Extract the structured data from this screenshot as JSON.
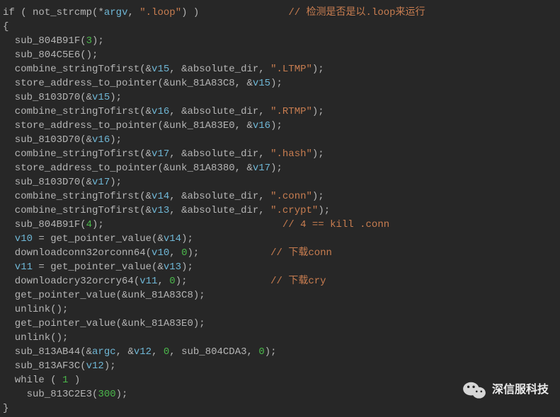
{
  "code": {
    "l1_kw": "if",
    "l1_p1": " ( ",
    "l1_fn": "not_strcmp",
    "l1_p2": "(",
    "l1_star": "*",
    "l1_arg": "argv",
    "l1_c": ", ",
    "l1_s": "\".loop\"",
    "l1_p3": ")",
    "l1_p4": " )",
    "l1_pad": "               ",
    "l1_cmt": "// 检测是否是以.loop来运行",
    "l2": "{",
    "l3_fn": "  sub_804B91F",
    "l3_p1": "(",
    "l3_n": "3",
    "l3_p2": ");",
    "l4": "  sub_804C5E6();",
    "l5_fn": "  combine_stringTofirst",
    "l5_p1": "(&",
    "l5_v": "v15",
    "l5_c1": ", &absolute_dir, ",
    "l5_s": "\".LTMP\"",
    "l5_p2": ");",
    "l6_fn": "  store_address_to_pointer",
    "l6_p1": "(&unk_81A83C8, &",
    "l6_v": "v15",
    "l6_p2": ");",
    "l7_fn": "  sub_8103D70",
    "l7_p1": "(&",
    "l7_v": "v15",
    "l7_p2": ");",
    "l8_fn": "  combine_stringTofirst",
    "l8_p1": "(&",
    "l8_v": "v16",
    "l8_c1": ", &absolute_dir, ",
    "l8_s": "\".RTMP\"",
    "l8_p2": ");",
    "l9_fn": "  store_address_to_pointer",
    "l9_p1": "(&unk_81A83E0, &",
    "l9_v": "v16",
    "l9_p2": ");",
    "l10_fn": "  sub_8103D70",
    "l10_p1": "(&",
    "l10_v": "v16",
    "l10_p2": ");",
    "l11_fn": "  combine_stringTofirst",
    "l11_p1": "(&",
    "l11_v": "v17",
    "l11_c1": ", &absolute_dir, ",
    "l11_s": "\".hash\"",
    "l11_p2": ");",
    "l12_fn": "  store_address_to_pointer",
    "l12_p1": "(&unk_81A8380, &",
    "l12_v": "v17",
    "l12_p2": ");",
    "l13_fn": "  sub_8103D70",
    "l13_p1": "(&",
    "l13_v": "v17",
    "l13_p2": ");",
    "l14_fn": "  combine_stringTofirst",
    "l14_p1": "(&",
    "l14_v": "v14",
    "l14_c1": ", &absolute_dir, ",
    "l14_s": "\".conn\"",
    "l14_p2": ");",
    "l15_fn": "  combine_stringTofirst",
    "l15_p1": "(&",
    "l15_v": "v13",
    "l15_c1": ", &absolute_dir, ",
    "l15_s": "\".crypt\"",
    "l15_p2": ");",
    "l16_fn": "  sub_804B91F",
    "l16_p1": "(",
    "l16_n": "4",
    "l16_p2": ");",
    "l16_pad": "                              ",
    "l16_cmt": "// 4 == kill .conn",
    "l17_v1": "  v10",
    "l17_a": " = get_pointer_value(&",
    "l17_v2": "v14",
    "l17_p": ");",
    "l18_fn": "  downloadconn32orconn64",
    "l18_p1": "(",
    "l18_v": "v10",
    "l18_c": ", ",
    "l18_n": "0",
    "l18_p2": ");",
    "l18_pad": "            ",
    "l18_cmt": "// 下载conn",
    "l19_v1": "  v11",
    "l19_a": " = get_pointer_value(&",
    "l19_v2": "v13",
    "l19_p": ");",
    "l20_fn": "  downloadcry32orcry64",
    "l20_p1": "(",
    "l20_v": "v11",
    "l20_c": ", ",
    "l20_n": "0",
    "l20_p2": ");",
    "l20_pad": "              ",
    "l20_cmt": "// 下载cry",
    "l21": "  get_pointer_value(&unk_81A83C8);",
    "l22": "  unlink();",
    "l23": "  get_pointer_value(&unk_81A83E0);",
    "l24": "  unlink();",
    "l25_fn": "  sub_813AB44",
    "l25_p1": "(&",
    "l25_a": "argc",
    "l25_c1": ", &",
    "l25_v": "v12",
    "l25_c2": ", ",
    "l25_n1": "0",
    "l25_c3": ", sub_804CDA3, ",
    "l25_n2": "0",
    "l25_p2": ");",
    "l26_fn": "  sub_813AF3C",
    "l26_p1": "(",
    "l26_v": "v12",
    "l26_p2": ");",
    "l27_a": "  while",
    "l27_b": " ( ",
    "l27_n": "1",
    "l27_c": " )",
    "l28_fn": "    sub_813C2E3",
    "l28_p1": "(",
    "l28_n": "300",
    "l28_p2": ");",
    "l29": "}"
  },
  "watermark": {
    "text": "深信服科技"
  }
}
